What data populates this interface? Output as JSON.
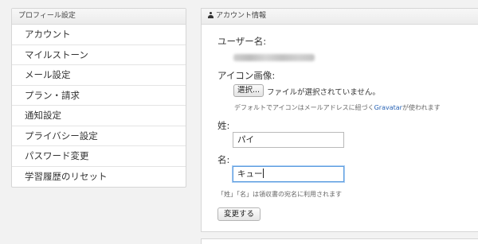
{
  "sidebar": {
    "title": "プロフィール設定",
    "items": [
      {
        "label": "アカウント"
      },
      {
        "label": "マイルストーン"
      },
      {
        "label": "メール設定"
      },
      {
        "label": "プラン・請求"
      },
      {
        "label": "通知設定"
      },
      {
        "label": "プライバシー設定"
      },
      {
        "label": "パスワード変更"
      },
      {
        "label": "学習履歴のリセット"
      }
    ]
  },
  "account": {
    "title": "アカウント情報",
    "username_label": "ユーザー名:",
    "icon_label": "アイコン画像:",
    "file_button": "選択...",
    "file_status": "ファイルが選択されていません。",
    "icon_note_prefix": "デフォルトでアイコンはメールアドレスに紐づく",
    "icon_note_link": "Gravatar",
    "icon_note_suffix": "が使われます",
    "last_name_label": "姓:",
    "last_name_value": "パイ",
    "first_name_label": "名:",
    "first_name_value": "キュー",
    "name_note": "「姓」「名」は領収書の宛名に利用されます",
    "submit_label": "変更する"
  },
  "icons": {
    "header_icon": "person-icon"
  }
}
